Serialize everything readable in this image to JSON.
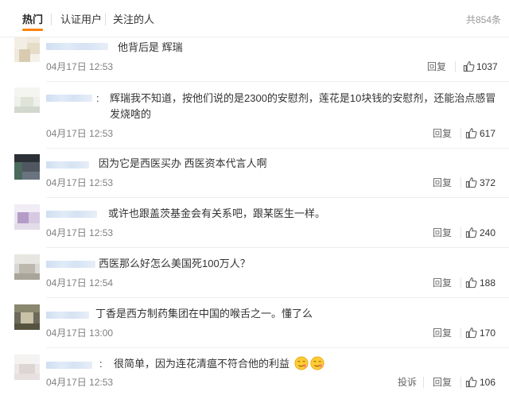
{
  "tabs": [
    {
      "label": "热门",
      "active": true
    },
    {
      "label": "认证用户",
      "active": false
    },
    {
      "label": "关注的人",
      "active": false
    }
  ],
  "total_count": "共854条",
  "reply_label": "回复",
  "report_label": "投诉",
  "comments": [
    {
      "text": "他背后是 辉瑞",
      "time": "04月17日 12:53",
      "likes": "1037"
    },
    {
      "text": "辉瑞我不知道，按他们说的是2300的安慰剂，莲花是10块钱的安慰剂，还能治点感冒发烧啥的",
      "time": "04月17日 12:53",
      "likes": "617"
    },
    {
      "text": "因为它是西医买办 西医资本代言人啊",
      "time": "04月17日 12:53",
      "likes": "372"
    },
    {
      "text": "或许也跟盖茨基金会有关系吧，跟某医生一样。",
      "time": "04月17日 12:53",
      "likes": "240"
    },
    {
      "text": "西医那么好怎么美国死100万人？",
      "time": "04月17日 12:54",
      "likes": "188"
    },
    {
      "text": "丁香是西方制药集团在中国的喉舌之一。懂了么",
      "time": "04月17日 13:00",
      "likes": "170"
    },
    {
      "text": "很简单，因为连花清瘟不符合他的利益",
      "time": "04月17日 12:53",
      "likes": "106",
      "emojis": [
        "smirk-emoji",
        "smirk-emoji"
      ]
    }
  ],
  "colors": {
    "accent": "#ff8200",
    "username_blur": "#d5e3f4",
    "muted": "#808080"
  },
  "icons": [
    "thumbs-up-icon",
    "smirk-emoji"
  ]
}
